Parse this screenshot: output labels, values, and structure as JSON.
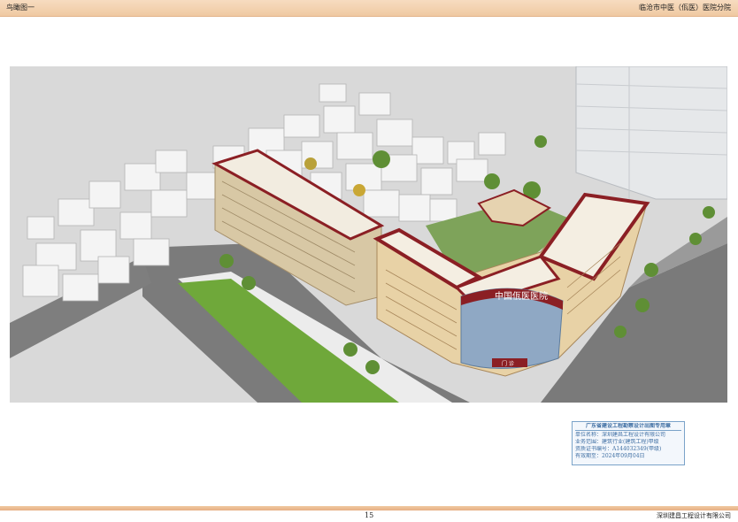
{
  "header": {
    "left_title": "鸟瞰图一",
    "right_title": "临沧市中医（佤医）医院分院"
  },
  "render": {
    "signboard_text": "中国佤医医院",
    "entrance_text": "门 诊"
  },
  "stamp": {
    "title": "广东省建设工程勘察设计出图专用章",
    "line1": "单位名称：深圳建昌工程设计有限公司",
    "line2": "业务范围：建筑行业(建筑工程)甲级",
    "line3": "资质证书编号：A144032349(甲级)",
    "line4": "有效期至：2024年09月04日"
  },
  "footer": {
    "page_number": "15",
    "company": "深圳建昌工程设计有限公司"
  }
}
